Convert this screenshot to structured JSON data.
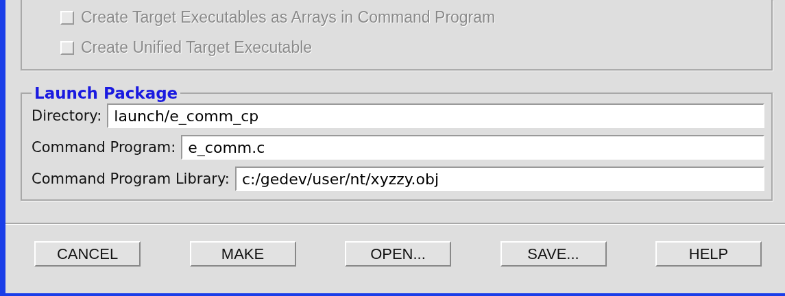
{
  "options": [
    {
      "label": "Create Target Executables as Arrays in Command Program",
      "checked": false,
      "disabled": true
    },
    {
      "label": "Create Unified Target Executable",
      "checked": false,
      "disabled": true
    }
  ],
  "launch_package": {
    "title": "Launch Package",
    "fields": [
      {
        "label": "Directory:",
        "value": "launch/e_comm_cp"
      },
      {
        "label": "Command Program:",
        "value": "e_comm.c"
      },
      {
        "label": "Command Program Library:",
        "value": "c:/gedev/user/nt/xyzzy.obj"
      }
    ]
  },
  "buttons": [
    "CANCEL",
    "MAKE",
    "OPEN...",
    "SAVE...",
    "HELP"
  ]
}
